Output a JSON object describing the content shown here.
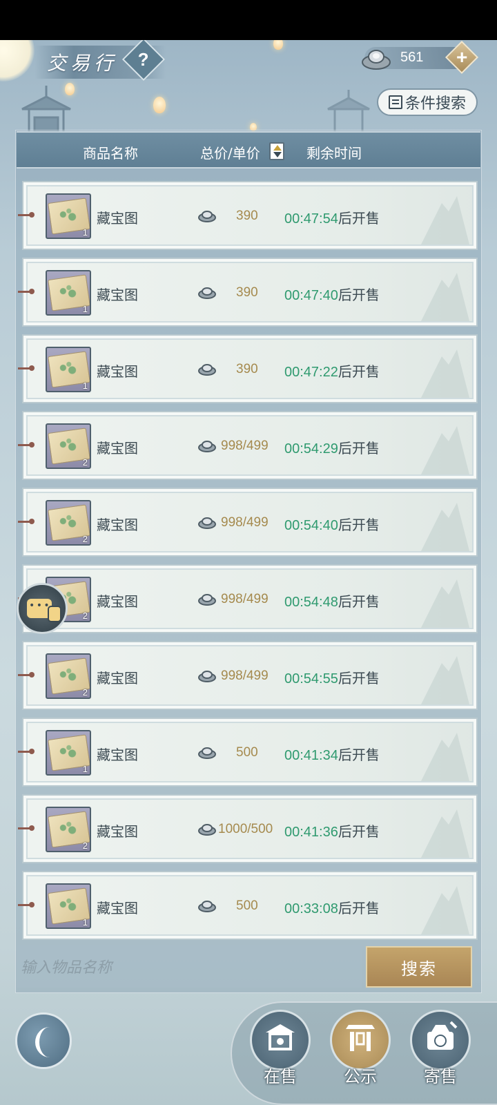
{
  "header": {
    "title": "交易行",
    "help_label": "?",
    "currency_amount": "561",
    "add_label": "+",
    "filter_label": "条件搜索"
  },
  "columns": {
    "name": "商品名称",
    "price": "总价/单价",
    "time": "剩余时间"
  },
  "listings": [
    {
      "name": "藏宝图",
      "qty": "1",
      "price": "390",
      "time": "00:47:54",
      "suffix": "后开售"
    },
    {
      "name": "藏宝图",
      "qty": "1",
      "price": "390",
      "time": "00:47:40",
      "suffix": "后开售"
    },
    {
      "name": "藏宝图",
      "qty": "1",
      "price": "390",
      "time": "00:47:22",
      "suffix": "后开售"
    },
    {
      "name": "藏宝图",
      "qty": "2",
      "price": "998/499",
      "time": "00:54:29",
      "suffix": "后开售"
    },
    {
      "name": "藏宝图",
      "qty": "2",
      "price": "998/499",
      "time": "00:54:40",
      "suffix": "后开售"
    },
    {
      "name": "藏宝图",
      "qty": "2",
      "price": "998/499",
      "time": "00:54:48",
      "suffix": "后开售"
    },
    {
      "name": "藏宝图",
      "qty": "2",
      "price": "998/499",
      "time": "00:54:55",
      "suffix": "后开售"
    },
    {
      "name": "藏宝图",
      "qty": "1",
      "price": "500",
      "time": "00:41:34",
      "suffix": "后开售"
    },
    {
      "name": "藏宝图",
      "qty": "2",
      "price": "1000/500",
      "time": "00:41:36",
      "suffix": "后开售"
    },
    {
      "name": "藏宝图",
      "qty": "1",
      "price": "500",
      "time": "00:33:08",
      "suffix": "后开售"
    }
  ],
  "search": {
    "placeholder": "输入物品名称",
    "button_label": "搜索"
  },
  "nav": {
    "tabs": [
      {
        "label": "在售",
        "icon": "pavilion-icon"
      },
      {
        "label": "公示",
        "icon": "gate-icon"
      },
      {
        "label": "寄售",
        "icon": "goods-icon"
      }
    ],
    "active_index": 1
  },
  "colors": {
    "price": "#a58a4e",
    "time": "#2f9a6f",
    "accent_gold": "#b89862",
    "header_blue": "#6f8ea2"
  }
}
